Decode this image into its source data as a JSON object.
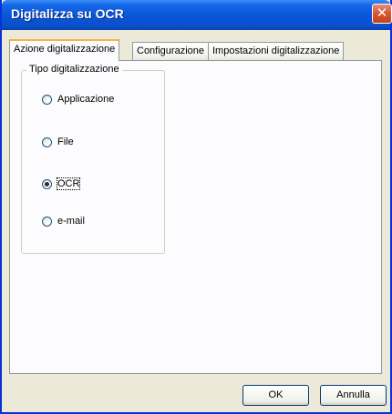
{
  "window": {
    "title": "Digitalizza su OCR",
    "close_glyph": "✕"
  },
  "tabs": [
    {
      "label": "Azione digitalizzazione",
      "active": true
    },
    {
      "label": "Configurazione",
      "active": false
    },
    {
      "label": "Impostazioni digitalizzazione",
      "active": false
    }
  ],
  "group": {
    "title": "Tipo digitalizzazione",
    "options": [
      {
        "label": "Applicazione",
        "checked": false
      },
      {
        "label": "File",
        "checked": false
      },
      {
        "label": "OCR",
        "checked": true
      },
      {
        "label": "e-mail",
        "checked": false
      }
    ]
  },
  "buttons": {
    "ok": "OK",
    "cancel": "Annulla"
  },
  "colors": {
    "titlebar": "#0a55d8",
    "close": "#d6542e",
    "dialog_bg": "#ece9d8",
    "active_tab_accent": "#f3b73f"
  }
}
